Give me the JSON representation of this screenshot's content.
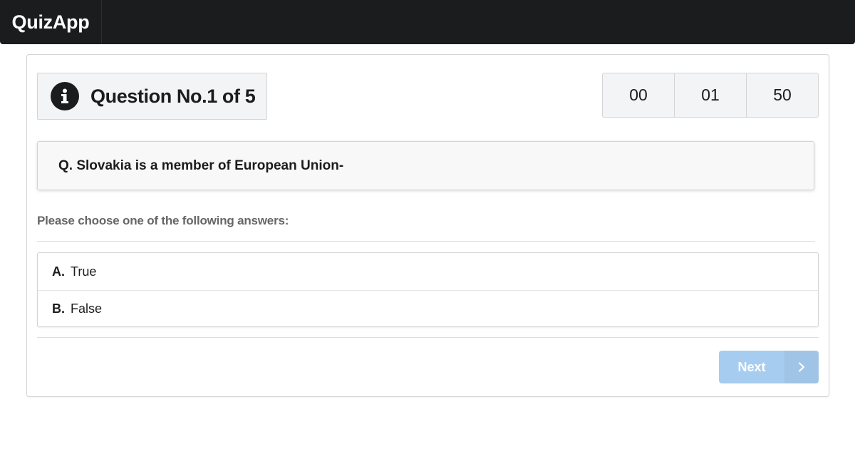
{
  "app": {
    "brand": "QuizApp"
  },
  "quiz": {
    "question_label": "Question No.1 of 5",
    "timer": {
      "hours": "00",
      "minutes": "01",
      "seconds": "50"
    },
    "question_text": "Q. Slovakia is a member of European Union-",
    "prompt": "Please choose one of the following answers:",
    "answers": [
      {
        "key": "A.",
        "text": "True"
      },
      {
        "key": "B.",
        "text": "False"
      }
    ],
    "next_label": "Next"
  },
  "icons": {
    "info": "info-circle-icon",
    "next": "chevron-right-icon"
  },
  "colors": {
    "navbar": "#1b1c1d",
    "next_button": "#a6cdef"
  }
}
